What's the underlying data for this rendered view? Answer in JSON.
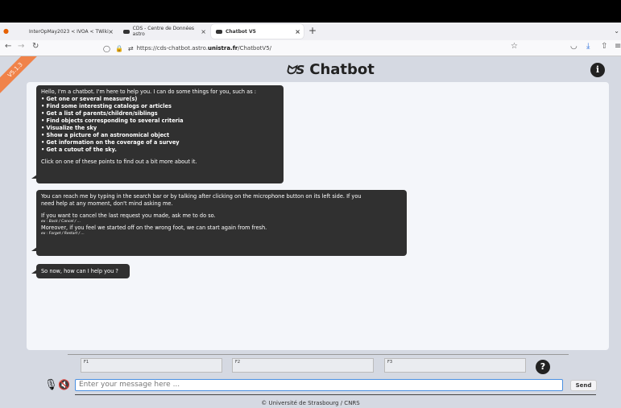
{
  "browser": {
    "tabs": [
      {
        "label": "InterOpMay2023 < IVOA < TWiki",
        "icon": "firefox-icon"
      },
      {
        "label": "CDS - Centre de Données astro",
        "icon": "cds-icon"
      },
      {
        "label": "Chatbot V5",
        "icon": "cds-icon"
      }
    ],
    "url_prefix": "https://cds-chatbot.astro.",
    "url_domain": "unistra.fr",
    "url_path": "/ChatbotV5/"
  },
  "app": {
    "ribbon": "V5.1.3",
    "title": "Chatbot",
    "logo": "ᗢS"
  },
  "messages": {
    "m1": {
      "intro": "Hello, I'm a chatbot. I'm here to help you. I can do some things for you, such as :",
      "items": [
        "• Get one or several measure(s)",
        "• Find some interesting catalogs or articles",
        "• Get a list of parents/children/siblings",
        "• Find objects corresponding to several criteria",
        "• Visualize the sky",
        "• Show a picture of an astronomical object",
        "• Get information on the coverage of a survey",
        "• Get a cutout of the sky."
      ],
      "outro": "Click on one of these points to find out a bit more about it."
    },
    "m2": {
      "l1": "You can reach me by typing in the search bar or by talking after clicking on the microphone button on its left side. If you",
      "l2": "need help at any moment, don't mind asking me.",
      "l3": "If you want to cancel the last request you made, ask me to do so.",
      "l4": "ex : Back / Cancel / ...",
      "l5": "Moreover, if you feel we started off on the wrong foot, we can start again from fresh.",
      "l6": "ex : Forget / Restart / ..."
    },
    "m3": "So now, how can I help you ?"
  },
  "functions": {
    "f1": "F1",
    "f2": "F2",
    "f3": "F3"
  },
  "input": {
    "placeholder": "Enter your message here ..."
  },
  "send_label": "Send",
  "footer": "© Université de Strasbourg / CNRS"
}
